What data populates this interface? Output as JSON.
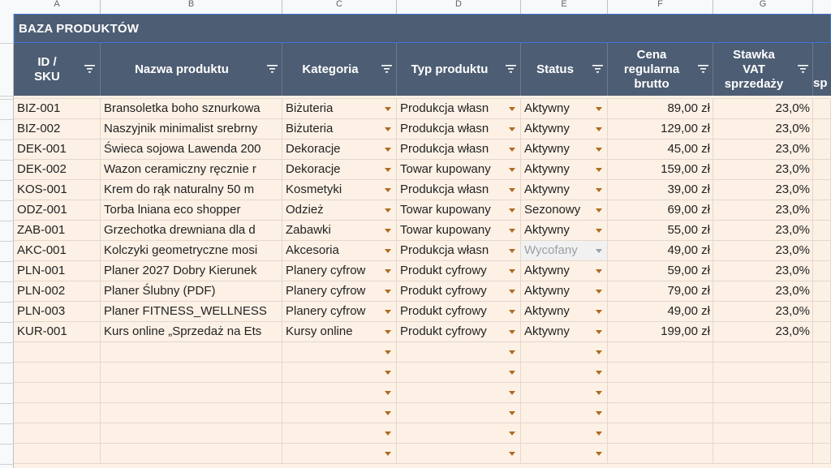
{
  "columns": {
    "letters": [
      "A",
      "B",
      "C",
      "D",
      "E",
      "F",
      "G"
    ]
  },
  "sheet": {
    "title": "BAZA PRODUKTÓW",
    "headers": {
      "id": [
        "ID /",
        "SKU"
      ],
      "name": "Nazwa produktu",
      "category": "Kategoria",
      "type": "Typ produktu",
      "status": "Status",
      "price": [
        "Cena",
        "regularna",
        "brutto"
      ],
      "vat": [
        "Stawka",
        "VAT",
        "sprzedaży"
      ],
      "next_partial": "sp"
    },
    "rows": [
      {
        "id": "BIZ-001",
        "name": "Bransoletka boho sznurkowa",
        "category": "Biżuteria",
        "type": "Produkcja własn",
        "status": "Aktywny",
        "price": "89,00 zł",
        "vat": "23,0%"
      },
      {
        "id": "BIZ-002",
        "name": "Naszyjnik minimalist srebrny",
        "category": "Biżuteria",
        "type": "Produkcja własn",
        "status": "Aktywny",
        "price": "129,00 zł",
        "vat": "23,0%"
      },
      {
        "id": "DEK-001",
        "name": "Świeca sojowa Lawenda 200",
        "category": "Dekoracje",
        "type": "Produkcja własn",
        "status": "Aktywny",
        "price": "45,00 zł",
        "vat": "23,0%"
      },
      {
        "id": "DEK-002",
        "name": "Wazon ceramiczny ręcznie r",
        "category": "Dekoracje",
        "type": "Towar kupowany",
        "status": "Aktywny",
        "price": "159,00 zł",
        "vat": "23,0%"
      },
      {
        "id": "KOS-001",
        "name": "Krem do rąk naturalny 50 m",
        "category": "Kosmetyki",
        "type": "Produkcja własn",
        "status": "Aktywny",
        "price": "39,00 zł",
        "vat": "23,0%"
      },
      {
        "id": "ODZ-001",
        "name": "Torba lniana eco shopper",
        "category": "Odzież",
        "type": "Towar kupowany",
        "status": "Sezonowy",
        "price": "69,00 zł",
        "vat": "23,0%"
      },
      {
        "id": "ZAB-001",
        "name": "Grzechotka drewniana dla d",
        "category": "Zabawki",
        "type": "Towar kupowany",
        "status": "Aktywny",
        "price": "55,00 zł",
        "vat": "23,0%"
      },
      {
        "id": "AKC-001",
        "name": "Kolczyki geometryczne mosi",
        "category": "Akcesoria",
        "type": "Produkcja własn",
        "status": "Wycofany",
        "price": "49,00 zł",
        "vat": "23,0%",
        "status_disabled": true
      },
      {
        "id": "PLN-001",
        "name": "Planer 2027 Dobry Kierunek",
        "category": "Planery cyfrow",
        "type": "Produkt cyfrowy",
        "status": "Aktywny",
        "price": "59,00 zł",
        "vat": "23,0%"
      },
      {
        "id": "PLN-002",
        "name": "Planer Ślubny (PDF)",
        "category": "Planery cyfrow",
        "type": "Produkt cyfrowy",
        "status": "Aktywny",
        "price": "79,00 zł",
        "vat": "23,0%"
      },
      {
        "id": "PLN-003",
        "name": "Planer FITNESS_WELLNESS",
        "category": "Planery cyfrow",
        "type": "Produkt cyfrowy",
        "status": "Aktywny",
        "price": "49,00 zł",
        "vat": "23,0%"
      },
      {
        "id": "KUR-001",
        "name": "Kurs online „Sprzedaż na Ets",
        "category": "Kursy online",
        "type": "Produkt cyfrowy",
        "status": "Aktywny",
        "price": "199,00 zł",
        "vat": "23,0%"
      }
    ],
    "empty_rows": 6
  },
  "colors": {
    "header_bg": "#4d5d73",
    "cell_bg": "#fdf1e6",
    "dropdown_arrow": "#b06a1f",
    "selection_border": "#3f74d6"
  }
}
